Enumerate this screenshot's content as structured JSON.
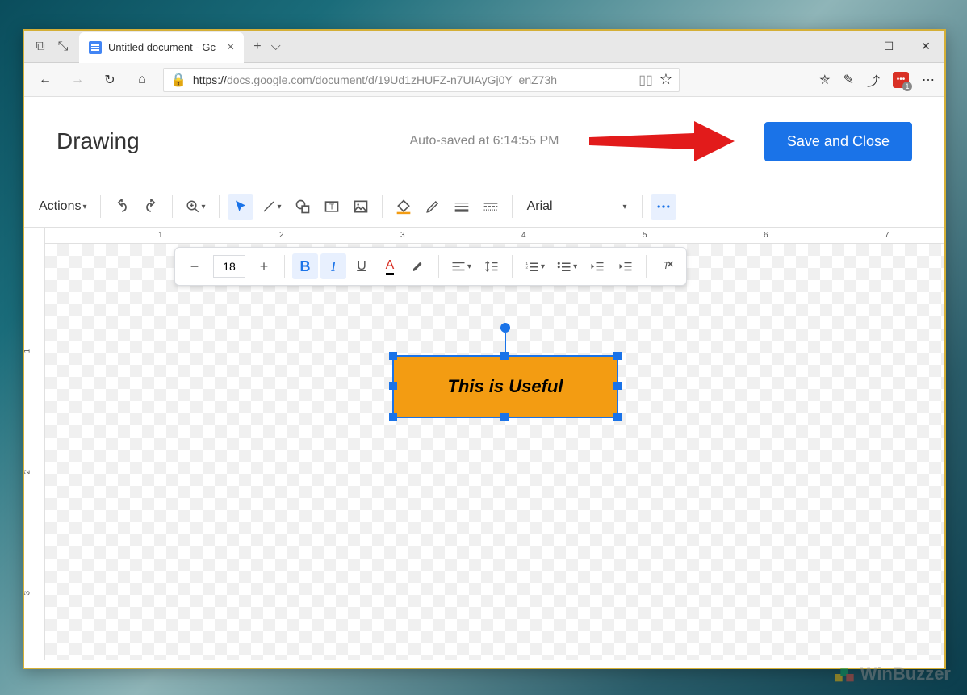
{
  "browser": {
    "tab_title": "Untitled document - Gc",
    "url_prefix": "https://",
    "url_rest": "docs.google.com/document/d/19Ud1zHUFZ-n7UIAyGj0Y_enZ73h",
    "ext_count": "1"
  },
  "dialog": {
    "title": "Drawing",
    "autosave": "Auto-saved at 6:14:55 PM",
    "save_button": "Save and Close"
  },
  "toolbar": {
    "actions_label": "Actions",
    "font_name": "Arial",
    "font_size": "18"
  },
  "ruler": {
    "h": [
      "1",
      "2",
      "3",
      "4",
      "5",
      "6",
      "7"
    ],
    "v": [
      "1",
      "2",
      "3"
    ]
  },
  "shape": {
    "text": "This is Useful"
  },
  "watermark": "WinBuzzer"
}
